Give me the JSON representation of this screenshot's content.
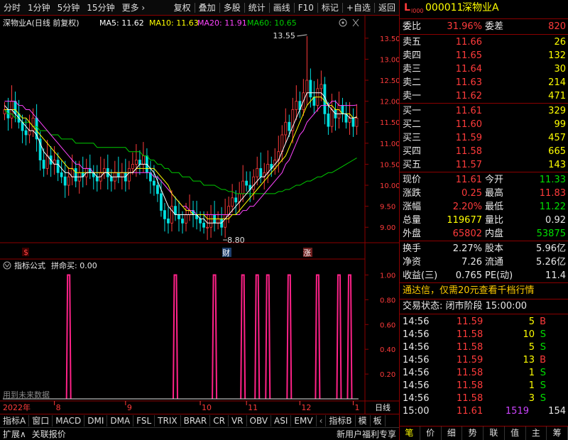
{
  "toolbar": {
    "left_items": [
      "分时",
      "1分钟",
      "5分钟",
      "15分钟",
      "更多"
    ],
    "more_arrow": "›",
    "right_items": [
      "复权",
      "叠加",
      "多股",
      "统计",
      "画线",
      "F10",
      "标记",
      "+自选",
      "返回"
    ]
  },
  "chart_header": {
    "stock_label": "深物业A(日线 前复权)",
    "ma5": "MA5: 11.62",
    "ma10": "MA10: 11.63",
    "ma20": "MA20: 11.91",
    "ma60": "MA60: 10.65",
    "colors": {
      "ma5": "#ffffff",
      "ma10": "#ffff00",
      "ma20": "#ff44ff",
      "ma60": "#00cc00"
    }
  },
  "chart_annotations": {
    "high_label": "13.55",
    "low_label": "8.80",
    "marker_cai": "财",
    "marker_zhang": "涨",
    "marker_dollar": "$"
  },
  "indicator": {
    "header_prefix": "指标公式",
    "header_value": "拼命买: 0.00",
    "watermark": "用到未来数据",
    "colors": {
      "signal": "#ff2288"
    }
  },
  "chart_data": [
    {
      "type": "candlestick",
      "title": "",
      "ylim": [
        8.7,
        13.7
      ],
      "y_ticks": [
        9.0,
        9.5,
        10.0,
        10.5,
        11.0,
        11.5,
        12.0,
        12.5,
        13.0,
        13.5
      ],
      "x_tick_labels": [
        "2022年",
        "8",
        "9",
        "10",
        "11",
        "12",
        "1"
      ],
      "x_tick_index": [
        0,
        14,
        34,
        55,
        68,
        83,
        98
      ],
      "bars": 100,
      "high": 13.55,
      "low": 8.8,
      "close_path": [
        11.8,
        11.6,
        12.0,
        11.7,
        11.5,
        11.3,
        11.2,
        11.3,
        11.6,
        11.1,
        10.6,
        10.4,
        10.7,
        10.5,
        10.6,
        10.3,
        10.2,
        10.0,
        10.2,
        10.4,
        10.1,
        10.3,
        10.2,
        10.4,
        10.3,
        10.2,
        10.1,
        10.3,
        10.4,
        10.2,
        10.1,
        10.3,
        10.2,
        10.3,
        10.1,
        10.4,
        10.5,
        10.6,
        10.5,
        10.7,
        10.3,
        10.1,
        10.0,
        9.8,
        9.4,
        9.2,
        9.1,
        9.5,
        9.3,
        9.2,
        9.1,
        9.3,
        9.4,
        9.3,
        9.2,
        9.1,
        9.0,
        9.0,
        9.3,
        9.1,
        9.2,
        9.0,
        9.3,
        9.5,
        9.7,
        9.6,
        9.8,
        10.1,
        10.0,
        9.9,
        10.2,
        10.4,
        10.2,
        10.3,
        10.5,
        10.4,
        10.6,
        10.8,
        11.2,
        11.5,
        11.3,
        11.8,
        12.0,
        11.8,
        12.2,
        12.5,
        12.1,
        11.9,
        12.3,
        12.4,
        11.7,
        11.4,
        11.8,
        11.6,
        11.9,
        11.7,
        11.5,
        11.6,
        11.4,
        11.6
      ],
      "ma5": [
        11.9,
        11.8,
        11.8,
        11.7,
        11.6,
        11.5,
        11.4,
        11.3,
        11.3,
        11.2,
        11.0,
        10.8,
        10.7,
        10.6,
        10.5,
        10.5,
        10.4,
        10.3,
        10.3,
        10.2,
        10.2,
        10.2,
        10.2,
        10.3,
        10.3,
        10.3,
        10.2,
        10.2,
        10.3,
        10.3,
        10.2,
        10.2,
        10.2,
        10.2,
        10.2,
        10.3,
        10.3,
        10.4,
        10.5,
        10.5,
        10.5,
        10.4,
        10.3,
        10.1,
        9.9,
        9.7,
        9.5,
        9.4,
        9.3,
        9.3,
        9.3,
        9.3,
        9.3,
        9.3,
        9.3,
        9.2,
        9.2,
        9.1,
        9.1,
        9.1,
        9.1,
        9.1,
        9.2,
        9.3,
        9.4,
        9.5,
        9.6,
        9.7,
        9.8,
        9.9,
        10.0,
        10.1,
        10.2,
        10.2,
        10.3,
        10.4,
        10.5,
        10.6,
        10.8,
        11.0,
        11.2,
        11.4,
        11.6,
        11.8,
        12.0,
        12.2,
        12.2,
        12.2,
        12.2,
        12.2,
        12.1,
        11.9,
        11.8,
        11.7,
        11.7,
        11.7,
        11.7,
        11.6,
        11.6,
        11.62
      ],
      "ma10": [
        11.8,
        11.8,
        11.8,
        11.8,
        11.7,
        11.6,
        11.6,
        11.5,
        11.4,
        11.3,
        11.2,
        11.1,
        11.0,
        10.9,
        10.8,
        10.7,
        10.6,
        10.5,
        10.4,
        10.4,
        10.3,
        10.3,
        10.3,
        10.3,
        10.3,
        10.3,
        10.3,
        10.3,
        10.3,
        10.3,
        10.3,
        10.3,
        10.3,
        10.3,
        10.3,
        10.3,
        10.3,
        10.4,
        10.4,
        10.4,
        10.4,
        10.4,
        10.4,
        10.3,
        10.2,
        10.1,
        10.0,
        9.8,
        9.7,
        9.6,
        9.5,
        9.4,
        9.4,
        9.3,
        9.3,
        9.3,
        9.3,
        9.2,
        9.2,
        9.2,
        9.2,
        9.2,
        9.2,
        9.2,
        9.3,
        9.3,
        9.4,
        9.5,
        9.6,
        9.7,
        9.8,
        9.9,
        10.0,
        10.1,
        10.2,
        10.3,
        10.4,
        10.5,
        10.6,
        10.7,
        10.9,
        11.1,
        11.3,
        11.5,
        11.7,
        11.9,
        12.0,
        12.1,
        12.1,
        12.1,
        12.0,
        11.9,
        11.9,
        11.8,
        11.8,
        11.7,
        11.7,
        11.7,
        11.6,
        11.63
      ],
      "ma20": [
        12.0,
        12.0,
        12.0,
        12.0,
        11.9,
        11.9,
        11.8,
        11.8,
        11.7,
        11.6,
        11.5,
        11.4,
        11.3,
        11.2,
        11.1,
        11.0,
        10.9,
        10.8,
        10.7,
        10.6,
        10.5,
        10.5,
        10.4,
        10.4,
        10.4,
        10.3,
        10.3,
        10.3,
        10.3,
        10.3,
        10.3,
        10.3,
        10.3,
        10.3,
        10.3,
        10.3,
        10.3,
        10.3,
        10.3,
        10.3,
        10.3,
        10.3,
        10.2,
        10.2,
        10.1,
        10.0,
        9.9,
        9.8,
        9.7,
        9.6,
        9.5,
        9.5,
        9.4,
        9.4,
        9.3,
        9.3,
        9.3,
        9.3,
        9.3,
        9.3,
        9.3,
        9.3,
        9.3,
        9.3,
        9.3,
        9.3,
        9.3,
        9.4,
        9.4,
        9.5,
        9.5,
        9.6,
        9.7,
        9.8,
        9.9,
        10.0,
        10.1,
        10.2,
        10.3,
        10.5,
        10.6,
        10.8,
        11.0,
        11.2,
        11.3,
        11.5,
        11.6,
        11.7,
        11.8,
        11.9,
        11.9,
        11.9,
        12.0,
        12.0,
        11.9,
        11.9,
        11.9,
        11.9,
        11.9,
        11.91
      ],
      "ma60": [
        11.8,
        11.7,
        11.7,
        11.6,
        11.6,
        11.5,
        11.5,
        11.5,
        11.4,
        11.4,
        11.3,
        11.3,
        11.3,
        11.2,
        11.2,
        11.2,
        11.1,
        11.1,
        11.1,
        11.1,
        11.0,
        11.0,
        11.0,
        11.0,
        11.0,
        11.0,
        10.9,
        10.9,
        10.9,
        10.9,
        10.9,
        10.9,
        10.9,
        10.9,
        10.9,
        10.8,
        10.8,
        10.8,
        10.8,
        10.7,
        10.7,
        10.6,
        10.6,
        10.5,
        10.5,
        10.4,
        10.4,
        10.3,
        10.3,
        10.3,
        10.2,
        10.2,
        10.2,
        10.1,
        10.1,
        10.1,
        10.0,
        10.0,
        10.0,
        10.0,
        9.95,
        9.9,
        9.9,
        9.85,
        9.85,
        9.8,
        9.8,
        9.8,
        9.8,
        9.8,
        9.8,
        9.8,
        9.8,
        9.8,
        9.8,
        9.8,
        9.8,
        9.85,
        9.85,
        9.9,
        9.9,
        9.95,
        10.0,
        10.0,
        10.05,
        10.1,
        10.1,
        10.15,
        10.2,
        10.2,
        10.25,
        10.3,
        10.3,
        10.35,
        10.4,
        10.45,
        10.5,
        10.55,
        10.6,
        10.65
      ]
    },
    {
      "type": "bar",
      "title": "",
      "ylim": [
        0,
        1.1
      ],
      "y_ticks": [
        0.2,
        0.4,
        0.6,
        0.8,
        1.0
      ],
      "signal_index": [
        18,
        48,
        59,
        67,
        71,
        74,
        80,
        88,
        94,
        97
      ],
      "values": [
        1,
        1,
        1,
        1,
        1,
        1,
        1,
        1,
        1,
        1
      ]
    }
  ],
  "bottom_tabs": [
    "指标A",
    "窗口",
    "MACD",
    "DMI",
    "DMA",
    "FSL",
    "TRIX",
    "BRAR",
    "CR",
    "VR",
    "OBV",
    "ASI",
    "EMV",
    "指标B",
    "模",
    "板"
  ],
  "bottom_right_label": "日线",
  "status_left": [
    "扩展∧",
    "关联报价"
  ],
  "status_right": "新用户福利专享",
  "quote": {
    "logo_l": "L",
    "logo_sub": "l000",
    "code": "000011",
    "name": "深物业A",
    "weibi_label": "委比",
    "weibi_value": "31.96%",
    "weicha_label": "委差",
    "weicha_value": "820",
    "asks": [
      {
        "label": "卖五",
        "price": "11.66",
        "vol": "26"
      },
      {
        "label": "卖四",
        "price": "11.65",
        "vol": "132"
      },
      {
        "label": "卖三",
        "price": "11.64",
        "vol": "30"
      },
      {
        "label": "卖二",
        "price": "11.63",
        "vol": "214"
      },
      {
        "label": "卖一",
        "price": "11.62",
        "vol": "471"
      }
    ],
    "bids": [
      {
        "label": "买一",
        "price": "11.61",
        "vol": "329"
      },
      {
        "label": "买二",
        "price": "11.60",
        "vol": "99"
      },
      {
        "label": "买三",
        "price": "11.59",
        "vol": "457"
      },
      {
        "label": "买四",
        "price": "11.58",
        "vol": "665"
      },
      {
        "label": "买五",
        "price": "11.57",
        "vol": "143"
      }
    ],
    "stats": [
      {
        "l1": "现价",
        "v1": "11.61",
        "l2": "今开",
        "v2": "11.33"
      },
      {
        "l1": "涨跌",
        "v1": "0.25",
        "l2": "最高",
        "v2": "11.83"
      },
      {
        "l1": "涨幅",
        "v1": "2.20%",
        "l2": "最低",
        "v2": "11.22"
      },
      {
        "l1": "总量",
        "v1": "119677",
        "l2": "量比",
        "v2": "0.92"
      },
      {
        "l1": "外盘",
        "v1": "65802",
        "l2": "内盘",
        "v2": "53875"
      }
    ],
    "stats2": [
      {
        "l1": "换手",
        "v1": "2.27%",
        "l2": "股本",
        "v2": "5.96亿"
      },
      {
        "l1": "净资",
        "v1": "7.26",
        "l2": "流通",
        "v2": "5.26亿"
      },
      {
        "l1": "收益(三)",
        "v1": "0.765",
        "l2": "PE(动)",
        "v2": "11.4"
      }
    ],
    "promo": "通达信，仅需20元查看千档行情",
    "trade_state": "交易状态: 闭市阶段 15:00:00",
    "ticks": [
      {
        "time": "14:56",
        "price": "11.59",
        "vol": "5",
        "side": "B"
      },
      {
        "time": "14:56",
        "price": "11.58",
        "vol": "10",
        "side": "S"
      },
      {
        "time": "14:56",
        "price": "11.58",
        "vol": "5",
        "side": "S"
      },
      {
        "time": "14:56",
        "price": "11.59",
        "vol": "13",
        "side": "B"
      },
      {
        "time": "14:56",
        "price": "11.58",
        "vol": "1",
        "side": "S"
      },
      {
        "time": "14:56",
        "price": "11.58",
        "vol": "1",
        "side": "S"
      },
      {
        "time": "14:56",
        "price": "11.58",
        "vol": "3",
        "side": "S"
      },
      {
        "time": "15:00",
        "price": "11.61",
        "vol": "1519",
        "side": "154"
      }
    ],
    "tabs": [
      "笔",
      "价",
      "细",
      "势",
      "联",
      "值",
      "主",
      "筹"
    ]
  }
}
